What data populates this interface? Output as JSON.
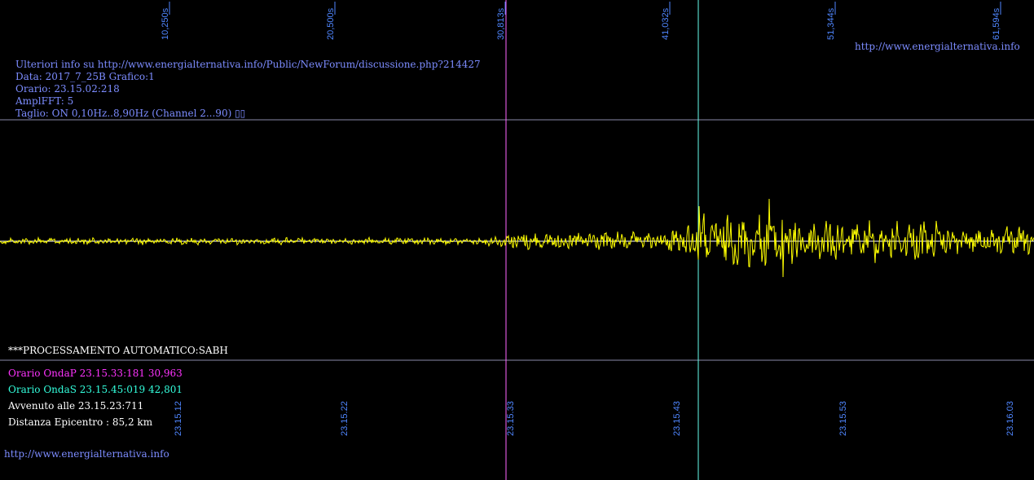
{
  "header": {
    "lines": [
      "Ulteriori info su http://www.energialternativa.info/Public/NewForum/discussione.php?214427",
      "Data: 2017_7_25B Grafico:1",
      "Orario: 23.15.02:218",
      "AmplFFT: 5",
      "Taglio: ON 0,10Hz..8,90Hz       (Channel 2...90) ▯▯"
    ],
    "url_top_right": "http://www.energialternativa.info"
  },
  "footer": {
    "processing": "***PROCESSAMENTO AUTOMATICO:SABH",
    "onda_p": "Orario OndaP 23.15.33:181  30,963",
    "onda_s": "Orario OndaS 23.15.45:019  42,801",
    "avvenuto": "Avvenuto alle 23.15.23:711",
    "distanza": "Distanza Epicentro : 85,2 km",
    "url_bottom_left": "http://www.energialternativa.info"
  },
  "colors": {
    "background": "#000000",
    "signal": "#ffff00",
    "guide_lines": "#8a8aa8",
    "axis_labels": "#4f86ff",
    "p_marker": "#ff66ff",
    "s_marker": "#66ffee",
    "header_text": "#7c8cff"
  },
  "chart_data": {
    "type": "line",
    "series": [
      {
        "values": []
      }
    ],
    "x_top_ticks": [
      "10,250s",
      "20,500s",
      "30,813s",
      "41,032s",
      "51,344s",
      "61,594s"
    ],
    "x_bottom_ticks": [
      "23.15.12",
      "23.15.22",
      "23.15.33",
      "23.15.43",
      "23.15.53",
      "23.16.03"
    ],
    "markers": [
      {
        "name": "OndaP",
        "time_s": 30.963
      },
      {
        "name": "OndaS",
        "time_s": 42.801
      }
    ],
    "xlim": [
      0,
      62.0
    ],
    "grid": false
  }
}
